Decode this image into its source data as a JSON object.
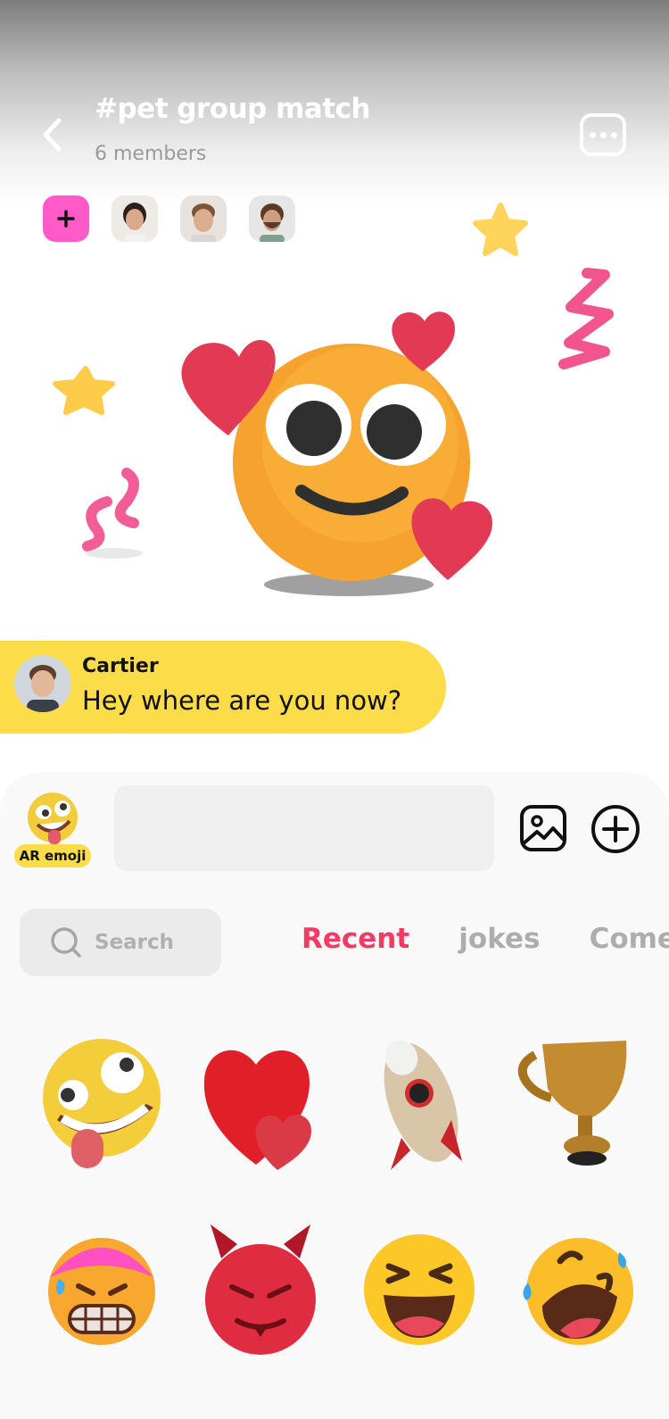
{
  "header": {
    "title": "#pet group match",
    "subtitle": "6 members",
    "back_icon": "chevron-left-icon",
    "more_icon": "more-dots-icon"
  },
  "members": {
    "add_icon": "plus-icon",
    "avatars": [
      "avatar-woman",
      "avatar-man-1",
      "avatar-man-2"
    ]
  },
  "message": {
    "author": "Cartier",
    "text": "Hey where are you now?"
  },
  "composer": {
    "ar_label": "AR emoji",
    "input_placeholder": "",
    "gallery_icon": "image-icon",
    "add_icon": "plus-circle-icon"
  },
  "sticker_browser": {
    "search_placeholder": "Search",
    "tabs": [
      {
        "label": "Recent",
        "active": true
      },
      {
        "label": "jokes",
        "active": false
      },
      {
        "label": "Comed",
        "active": false
      }
    ],
    "stickers": [
      "crazy-face",
      "hearts",
      "rocket",
      "trophy",
      "grimacing-face",
      "smiling-devil",
      "laughing-face",
      "rolling-laughing-face"
    ]
  },
  "colors": {
    "accent": "#f73a64",
    "bubble": "#fcdc48",
    "add_member": "#ff5ac8"
  }
}
